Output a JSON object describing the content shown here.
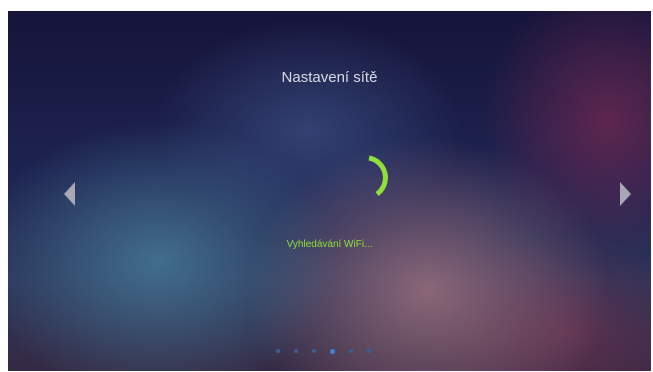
{
  "screen": {
    "title": "Nastavení sítě",
    "status_text": "Vyhledávání WiFi...",
    "accent_color": "#8fe03a"
  },
  "navigation": {
    "prev_icon": "chevron-left-icon",
    "next_icon": "chevron-right-icon"
  },
  "pager": {
    "total_pages": 6,
    "active_page": 4
  },
  "spinner": {
    "icon": "loading-spinner-icon"
  }
}
